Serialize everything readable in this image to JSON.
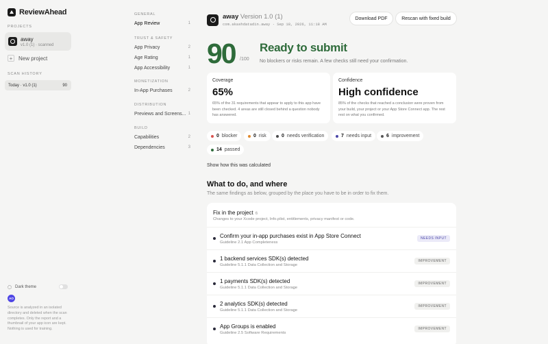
{
  "brand": {
    "name": "ReviewAhead"
  },
  "sidebar": {
    "projects_label": "PROJECTS",
    "project": {
      "name": "away",
      "sub": "v1.0 (1) · scanned"
    },
    "new_project": "New project",
    "scan_history_label": "SCAN HISTORY",
    "history": {
      "label": "Today · v1.0 (1)",
      "score": "90"
    },
    "dark_theme": "Dark theme",
    "avatar": "AO",
    "note": "Source is analyzed in an isolated directory and deleted when the scan completes. Only the report and a thumbnail of your app icon are kept. Nothing is used for training."
  },
  "nav": {
    "groups": [
      {
        "label": "GENERAL",
        "items": [
          {
            "label": "App Review",
            "count": "1"
          }
        ]
      },
      {
        "label": "TRUST & SAFETY",
        "items": [
          {
            "label": "App Privacy",
            "count": "2"
          },
          {
            "label": "Age Rating",
            "count": "1"
          },
          {
            "label": "App Accessibility",
            "count": "1"
          }
        ]
      },
      {
        "label": "MONETIZATION",
        "items": [
          {
            "label": "In-App Purchases",
            "count": "2"
          }
        ]
      },
      {
        "label": "DISTRIBUTION",
        "items": [
          {
            "label": "Previews and Screens...",
            "count": "1"
          }
        ]
      },
      {
        "label": "BUILD",
        "items": [
          {
            "label": "Capabilities",
            "count": "2"
          },
          {
            "label": "Dependencies",
            "count": "3"
          }
        ]
      }
    ]
  },
  "header": {
    "app_name": "away",
    "version": "Version 1.0 (1)",
    "bundle": "com.akashdatadin.away · Sep 18, 2026, 11:18 AM",
    "download_pdf": "Download PDF",
    "rescan": "Rescan with fixed build"
  },
  "score": {
    "value": "90",
    "of": "/100",
    "status": "Ready to submit",
    "status_sub": "No blockers or risks remain. A few checks still need your confirmation."
  },
  "coverage": {
    "label": "Coverage",
    "value": "65%",
    "desc": "65% of the 31 requirements that appear to apply to this app have been checked. 4 areas are still closed behind a question nobody has answered."
  },
  "confidence": {
    "label": "Confidence",
    "value": "High confidence",
    "desc": "85% of the checks that reached a conclusion were proven from your build, your project or your App Store Connect app. The rest rest on what you confirmed."
  },
  "pills": [
    {
      "count": "0",
      "label": "blocker",
      "color": "#d9534f"
    },
    {
      "count": "0",
      "label": "risk",
      "color": "#e08a2e"
    },
    {
      "count": "0",
      "label": "needs verification",
      "color": "#4a4a4a"
    },
    {
      "count": "7",
      "label": "needs input",
      "color": "#4b47a8"
    },
    {
      "count": "6",
      "label": "improvement",
      "color": "#555555"
    },
    {
      "count": "14",
      "label": "passed",
      "color": "#2e6b3a"
    }
  ],
  "calc_link": "Show how this was calculated",
  "what_todo": {
    "title": "What to do, and where",
    "sub": "The same findings as below, grouped by the place you have to be in order to fix them."
  },
  "fix": {
    "title": "Fix in the project",
    "count": "6",
    "sub": "Changes to your Xcode project, Info.plist, entitlements, privacy manifest or code.",
    "rows": [
      {
        "title": "Confirm your in-app purchases exist in App Store Connect",
        "sub": "Guideline 2.1 App Completeness",
        "tag": "NEEDS INPUT",
        "kind": "needs"
      },
      {
        "title": "1 backend services SDK(s) detected",
        "sub": "Guideline 5.1.1 Data Collection and Storage",
        "tag": "IMPROVEMENT",
        "kind": "improve"
      },
      {
        "title": "1 payments SDK(s) detected",
        "sub": "Guideline 5.1.1 Data Collection and Storage",
        "tag": "IMPROVEMENT",
        "kind": "improve"
      },
      {
        "title": "2 analytics SDK(s) detected",
        "sub": "Guideline 5.1.1 Data Collection and Storage",
        "tag": "IMPROVEMENT",
        "kind": "improve"
      },
      {
        "title": "App Groups is enabled",
        "sub": "Guideline 2.5 Software Requirements",
        "tag": "IMPROVEMENT",
        "kind": "improve"
      }
    ]
  }
}
